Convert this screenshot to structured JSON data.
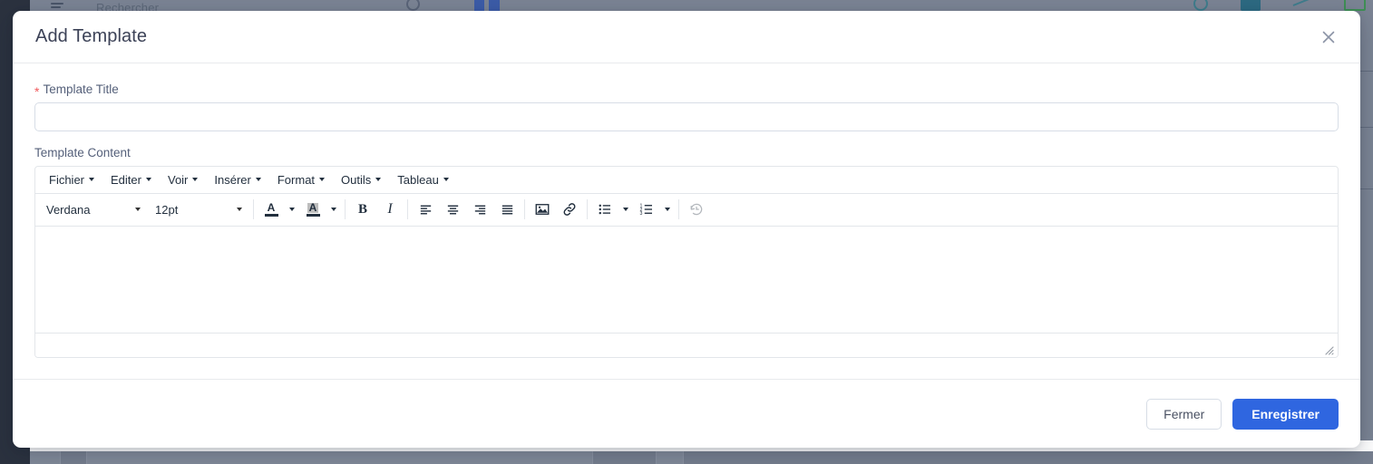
{
  "background": {
    "search_placeholder": "Rechercher",
    "icons": [
      {
        "name": "hamburger-menu-icon"
      },
      {
        "name": "search-icon"
      },
      {
        "name": "app-logo-icon"
      },
      {
        "name": "history-clock-icon"
      },
      {
        "name": "id-card-icon"
      },
      {
        "name": "chart-line-icon"
      },
      {
        "name": "monitor-chart-icon"
      }
    ],
    "sidebar_color": "#2b323f",
    "topbar_color": "#7b8494"
  },
  "modal": {
    "title": "Add Template",
    "close_icon": "close-icon",
    "form": {
      "title_field": {
        "label": "Template Title",
        "required_marker": "*",
        "value": "",
        "placeholder": ""
      },
      "content_field": {
        "label": "Template Content",
        "value": ""
      }
    },
    "editor": {
      "menubar": [
        {
          "label": "Fichier",
          "name": "menu-fichier"
        },
        {
          "label": "Editer",
          "name": "menu-editer"
        },
        {
          "label": "Voir",
          "name": "menu-voir"
        },
        {
          "label": "Insérer",
          "name": "menu-inserer"
        },
        {
          "label": "Format",
          "name": "menu-format"
        },
        {
          "label": "Outils",
          "name": "menu-outils"
        },
        {
          "label": "Tableau",
          "name": "menu-tableau"
        }
      ],
      "font_family": "Verdana",
      "font_size": "12pt",
      "toolbar_icons": [
        "text-color-icon",
        "background-color-icon",
        "bold-icon",
        "italic-icon",
        "align-left-icon",
        "align-center-icon",
        "align-right-icon",
        "align-justify-icon",
        "insert-image-icon",
        "insert-link-icon",
        "bullet-list-icon",
        "numbered-list-icon",
        "restore-draft-icon"
      ],
      "color_glyph": "A",
      "bold_glyph": "B",
      "italic_glyph": "I",
      "body_text": ""
    },
    "footer": {
      "close_label": "Fermer",
      "save_label": "Enregistrer",
      "primary_color": "#2f66e0"
    }
  }
}
